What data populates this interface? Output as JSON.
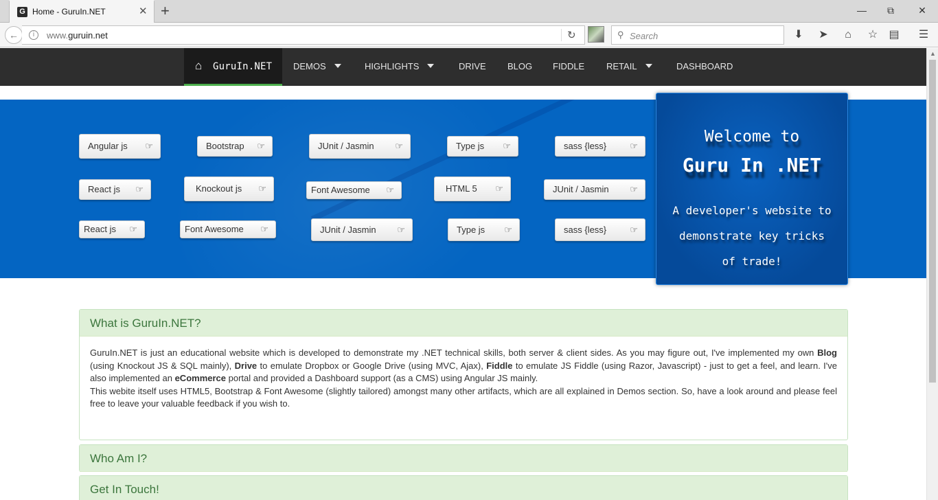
{
  "browser": {
    "tab_title": "Home - GuruIn.NET",
    "favicon_letter": "G",
    "tab_close": "✕",
    "new_tab": "+",
    "url_host": "www.",
    "url_domain": "guruin.net",
    "search_placeholder": "Search"
  },
  "site": {
    "brand": "GuruIn.NET",
    "menu": [
      {
        "label": "DEMOS"
      },
      {
        "label": "HIGHLIGHTS"
      },
      {
        "label": "DRIVE"
      },
      {
        "label": "BLOG"
      },
      {
        "label": "FIDDLE"
      },
      {
        "label": "RETAIL"
      },
      {
        "label": "DASHBOARD"
      }
    ]
  },
  "tags": [
    "Angular js",
    "Bootstrap",
    "JUnit / Jasmin",
    "Type js",
    "sass {less}",
    "React js",
    "Knockout js",
    "Font Awesome",
    "HTML 5",
    "JUnit / Jasmin",
    "React js",
    "Font Awesome",
    "JUnit / Jasmin",
    "Type js",
    "sass {less}"
  ],
  "welcome": {
    "line1": "Welcome to",
    "line2": "Guru In .NET",
    "tagline": "A developer's website to demonstrate key tricks of trade!"
  },
  "panels": {
    "what": {
      "title": "What is GuruIn.NET?",
      "p1_a": "GuruIn.NET is just an educational website which is developed to demonstrate my .NET technical skills, both server & client sides. As you may figure out, I've implemented my own ",
      "p1_blog": "Blog",
      "p1_b": " (using Knockout JS & SQL mainly), ",
      "p1_drive": "Drive",
      "p1_c": " to emulate Dropbox or Google Drive (using MVC, Ajax), ",
      "p1_fiddle": "Fiddle",
      "p1_d": " to emulate JS Fiddle (using Razor, Javascript) - just to get a feel, and learn. I've also implemented an ",
      "p1_ecom": "eCommerce",
      "p1_e": " portal and provided a Dashboard support (as a CMS) using Angular JS mainly.",
      "p2": "This webite itself uses HTML5, Bootstrap & Font Awesome (slightly tailored) amongst many other artifacts, which are all explained in Demos section. So, have a look around and please feel free to leave your valuable feedback if you wish to."
    },
    "who": {
      "title": "Who Am I?"
    },
    "touch": {
      "title": "Get In Touch!"
    }
  }
}
